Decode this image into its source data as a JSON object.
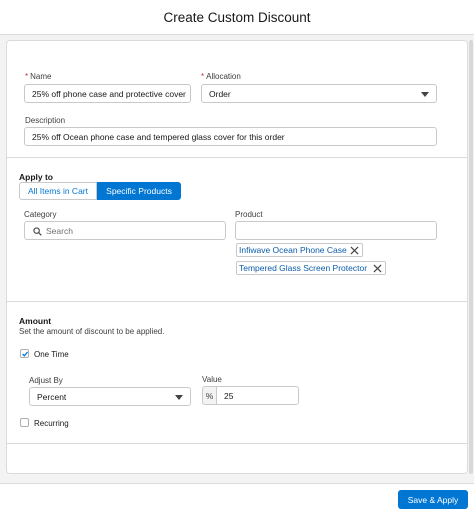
{
  "modal": {
    "title": "Create Custom Discount"
  },
  "details": {
    "name_label": "Name",
    "name_value": "25% off phone case and protective cover",
    "allocation_label": "Allocation",
    "allocation_value": "Order",
    "description_label": "Description",
    "description_value": "25% off Ocean phone case and tempered glass cover for this order"
  },
  "apply_to": {
    "title": "Apply to",
    "tabs": [
      {
        "label": "All Items in Cart",
        "selected": false
      },
      {
        "label": "Specific Products",
        "selected": true
      }
    ],
    "category_label": "Category",
    "category_placeholder": "Search",
    "product_label": "Product",
    "products": [
      "Infiwave Ocean Phone Case",
      "Tempered Glass Screen Protector"
    ]
  },
  "amount": {
    "title": "Amount",
    "helptext": "Set the amount of discount to be applied.",
    "one_time_label": "One Time",
    "one_time_checked": true,
    "adjust_by_label": "Adjust By",
    "adjust_by_value": "Percent",
    "value_label": "Value",
    "value_unit": "%",
    "value": "25",
    "recurring_label": "Recurring",
    "recurring_checked": false
  },
  "footer": {
    "apply_label": "Save & Apply"
  },
  "colors": {
    "brand": "#0176d3",
    "required": "#c23934",
    "pill_text": "#0b5cab"
  }
}
